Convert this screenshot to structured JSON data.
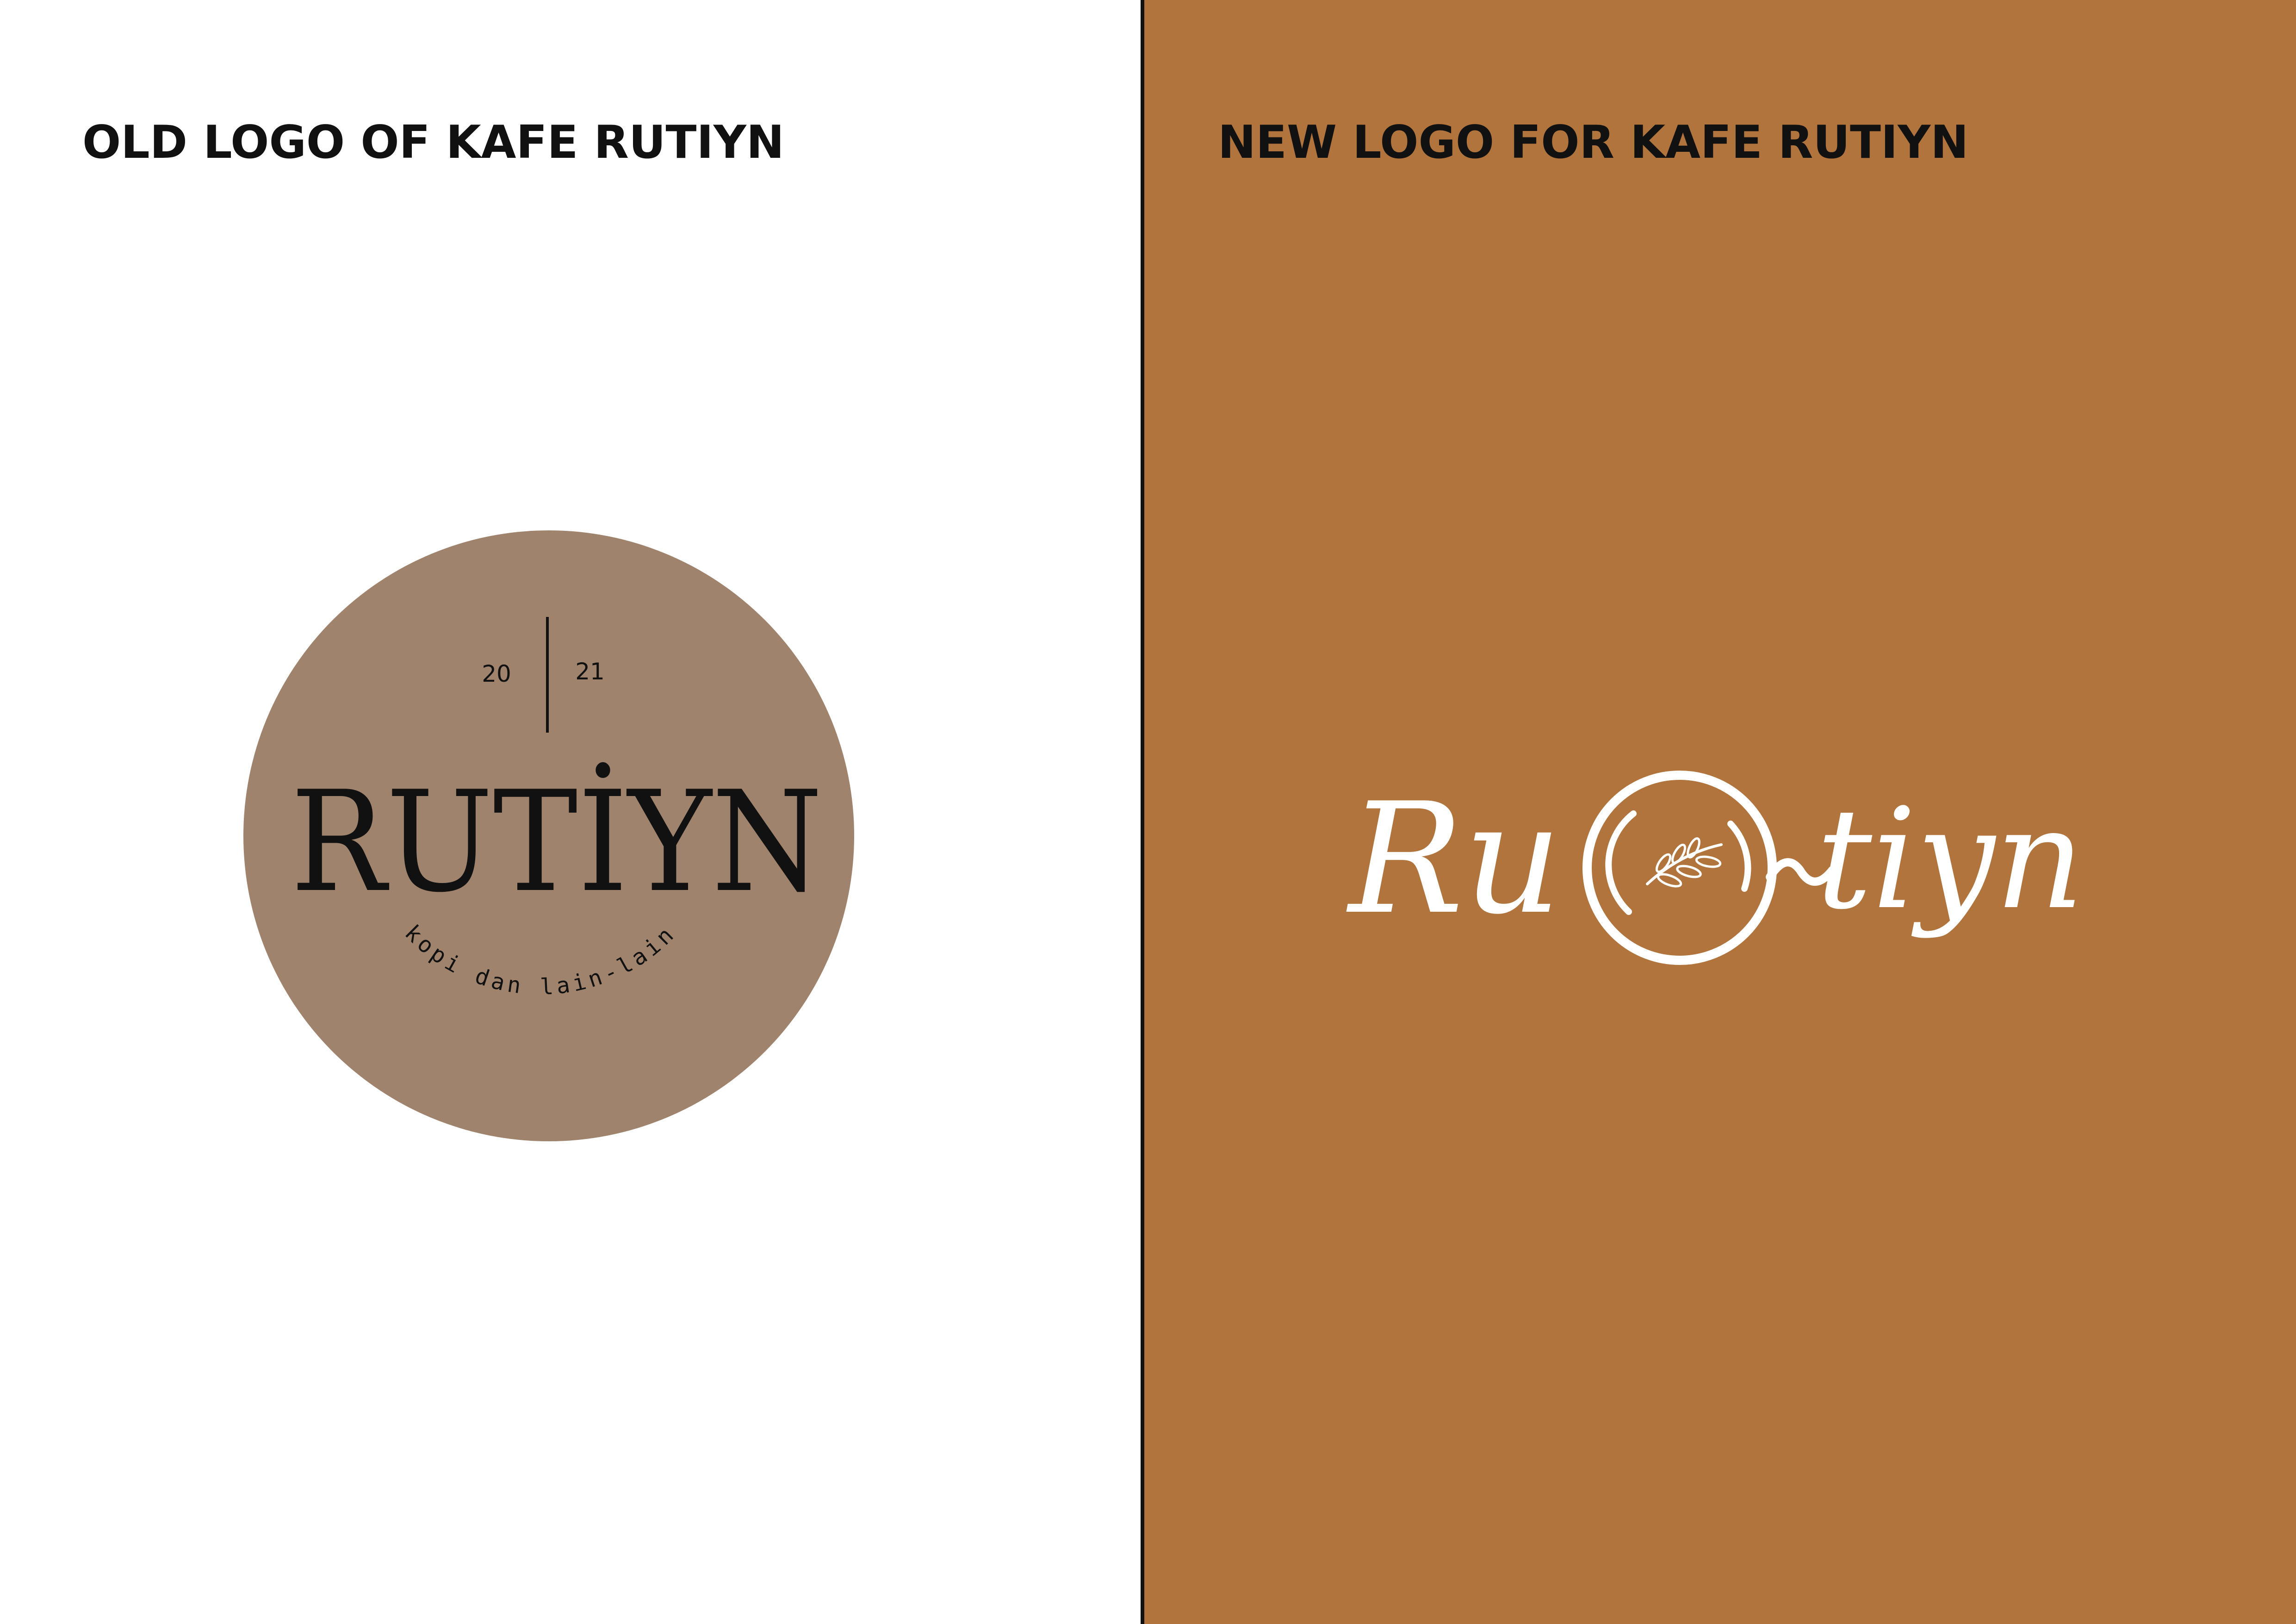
{
  "left_panel": {
    "heading": "OLD LOGO OF KAFE RUTIYN",
    "old_logo": {
      "year_left": "20",
      "year_right": "21",
      "wordmark": "RUTİYN",
      "tagline": "kopi dan lain-lain",
      "badge_color": "#9f836d",
      "text_color": "#111111"
    }
  },
  "right_panel": {
    "heading": "NEW LOGO FOR KAFE RUTIYN",
    "background_color": "#b0743c",
    "new_logo": {
      "wordmark_start": "Ru",
      "wordmark_end": "tiyn",
      "logo_color": "#ffffff",
      "icon": "coffee-cup-leaf-icon"
    }
  }
}
